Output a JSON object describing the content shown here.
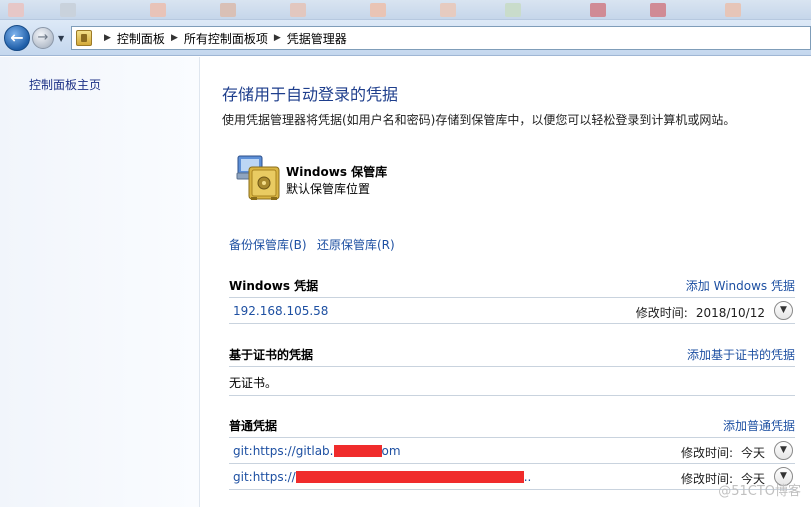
{
  "nav": {
    "breadcrumbs": [
      "控制面板",
      "所有控制面板项",
      "凭据管理器"
    ],
    "back_icon": "back-arrow-icon",
    "forward_icon": "forward-arrow-icon"
  },
  "left": {
    "home_link": "控制面板主页"
  },
  "main": {
    "title": "存储用于自动登录的凭据",
    "description": "使用凭据管理器将凭据(如用户名和密码)存储到保管库中，以便您可以轻松登录到计算机或网站。",
    "vault": {
      "name": "Windows 保管库",
      "subtitle": "默认保管库位置",
      "icon": "vault-safe-icon"
    },
    "backup_link": "备份保管库(B)",
    "restore_link": "还原保管库(R)"
  },
  "sections": {
    "windows": {
      "title": "Windows 凭据",
      "add": "添加 Windows 凭据",
      "rows": [
        {
          "name": "192.168.105.58",
          "meta_label": "修改时间:",
          "meta_value": "2018/10/12"
        }
      ]
    },
    "cert": {
      "title": "基于证书的凭据",
      "add": "添加基于证书的凭据",
      "empty": "无证书。"
    },
    "generic": {
      "title": "普通凭据",
      "add": "添加普通凭据",
      "rows": [
        {
          "prefix": "git:https://gitlab.",
          "suffix": "om",
          "meta_label": "修改时间:",
          "meta_value": "今天"
        },
        {
          "prefix": "git:https://",
          "suffix": "..",
          "meta_label": "修改时间:",
          "meta_value": "今天"
        }
      ]
    }
  },
  "watermark": "@51CTO博客",
  "colors": {
    "link": "#1e50a2",
    "title": "#1e3e8c",
    "redaction": "#f02c2c"
  }
}
